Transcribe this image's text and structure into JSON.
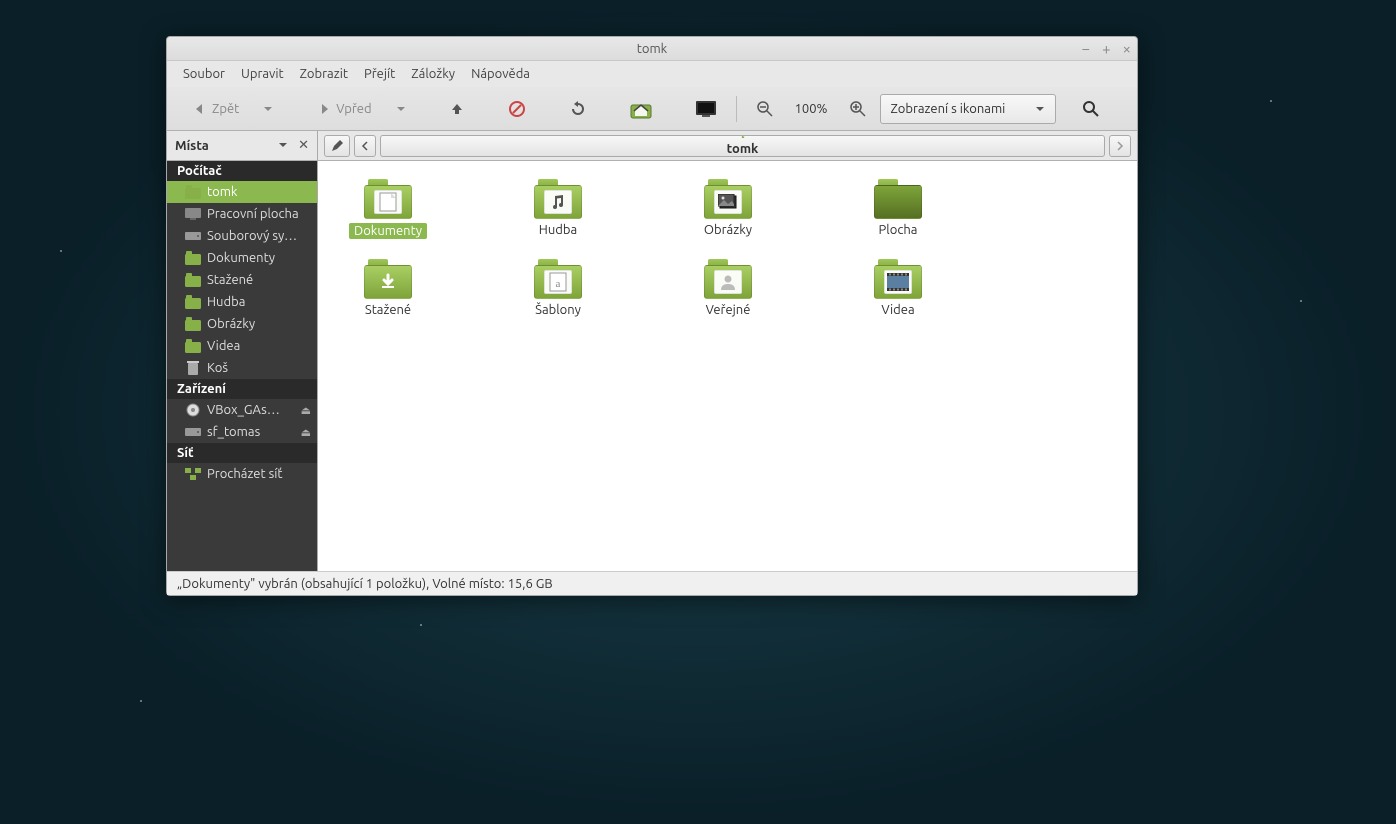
{
  "window": {
    "title": "tomk"
  },
  "menu": {
    "file": "Soubor",
    "edit": "Upravit",
    "view": "Zobrazit",
    "go": "Přejít",
    "bookmarks": "Záložky",
    "help": "Nápověda"
  },
  "toolbar": {
    "back": "Zpět",
    "forward": "Vpřed",
    "zoom_level": "100%",
    "view_mode": "Zobrazení s ikonami"
  },
  "sidebar": {
    "title": "Místa",
    "sections": [
      {
        "heading": "Počítač",
        "items": [
          {
            "label": "tomk",
            "icon": "home",
            "selected": true
          },
          {
            "label": "Pracovní plocha",
            "icon": "desktop"
          },
          {
            "label": "Souborový sy…",
            "icon": "drive"
          },
          {
            "label": "Dokumenty",
            "icon": "folder"
          },
          {
            "label": "Stažené",
            "icon": "folder"
          },
          {
            "label": "Hudba",
            "icon": "folder"
          },
          {
            "label": "Obrázky",
            "icon": "folder"
          },
          {
            "label": "Videa",
            "icon": "folder"
          },
          {
            "label": "Koš",
            "icon": "trash"
          }
        ]
      },
      {
        "heading": "Zařízení",
        "items": [
          {
            "label": "VBox_GAs…",
            "icon": "disc",
            "eject": true
          },
          {
            "label": "sf_tomas",
            "icon": "drive",
            "eject": true
          }
        ]
      },
      {
        "heading": "Síť",
        "items": [
          {
            "label": "Procházet síť",
            "icon": "network"
          }
        ]
      }
    ]
  },
  "pathbar": {
    "current": "tomk"
  },
  "folders": [
    {
      "label": "Dokumenty",
      "type": "documents",
      "selected": true
    },
    {
      "label": "Hudba",
      "type": "music"
    },
    {
      "label": "Obrázky",
      "type": "pictures"
    },
    {
      "label": "Plocha",
      "type": "desktop"
    },
    {
      "label": "Stažené",
      "type": "downloads"
    },
    {
      "label": "Šablony",
      "type": "templates"
    },
    {
      "label": "Veřejné",
      "type": "public"
    },
    {
      "label": "Videa",
      "type": "videos"
    }
  ],
  "statusbar": {
    "text": "„Dokumenty\" vybrán (obsahující 1 položku), Volné místo: 15,6 GB"
  }
}
